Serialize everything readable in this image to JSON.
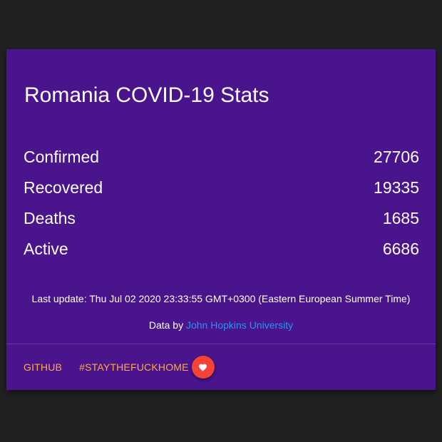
{
  "card": {
    "title": "Romania COVID-19 Stats",
    "stats": [
      {
        "label": "Confirmed",
        "value": "27706"
      },
      {
        "label": "Recovered",
        "value": "19335"
      },
      {
        "label": "Deaths",
        "value": "1685"
      },
      {
        "label": "Active",
        "value": "6686"
      }
    ],
    "last_update": "Last update: Thu Jul 02 2020 23:33:55 GMT+0300 (Eastern European Summer Time)",
    "source_prefix": "Data by",
    "source_link": "John Hopkins University"
  },
  "actions": {
    "github_label": "GITHUB",
    "hashtag_label": "#STAYTHEFUCKHOME",
    "heart_icon": "heart-icon"
  },
  "colors": {
    "page_background": "#212121",
    "card_background": "#4a148c",
    "link_blue": "#2196f3",
    "action_orange": "#ffab40",
    "fab_red": "#f44336"
  }
}
